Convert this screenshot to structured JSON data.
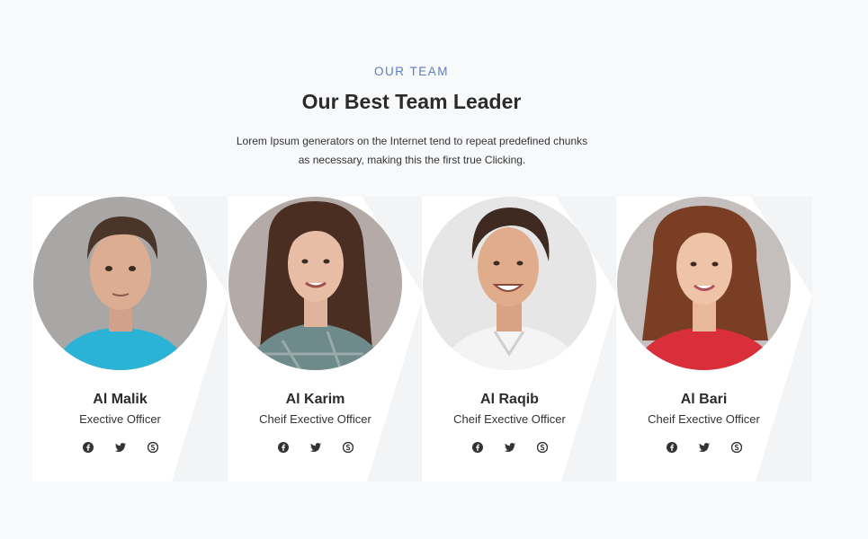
{
  "header": {
    "eyebrow": "OUR TEAM",
    "title": "Our Best Team Leader",
    "description": "Lorem Ipsum generators on the Internet tend to repeat predefined chunks as necessary, making this the first true Clicking."
  },
  "team": [
    {
      "name": "Al Malik",
      "role": "Exective Officer",
      "photo": "man-blue-tshirt-photo",
      "shirt_color": "#2bb3d6"
    },
    {
      "name": "Al Karim",
      "role": "Cheif Exective Officer",
      "photo": "woman-plaid-shirt-photo",
      "shirt_color": "#6f8a8a"
    },
    {
      "name": "Al Raqib",
      "role": "Cheif Exective Officer",
      "photo": "man-white-shirt-photo",
      "shirt_color": "#f2f2f2"
    },
    {
      "name": "Al Bari",
      "role": "Cheif Exective Officer",
      "photo": "woman-red-top-photo",
      "shirt_color": "#d92f3a"
    }
  ],
  "social_icons": [
    "facebook-icon",
    "twitter-icon",
    "skype-icon"
  ],
  "colors": {
    "accent": "#5a7fc4",
    "page_bg": "#f8f9fb",
    "card_bg": "#ffffff",
    "heading": "#2b2b2b"
  }
}
